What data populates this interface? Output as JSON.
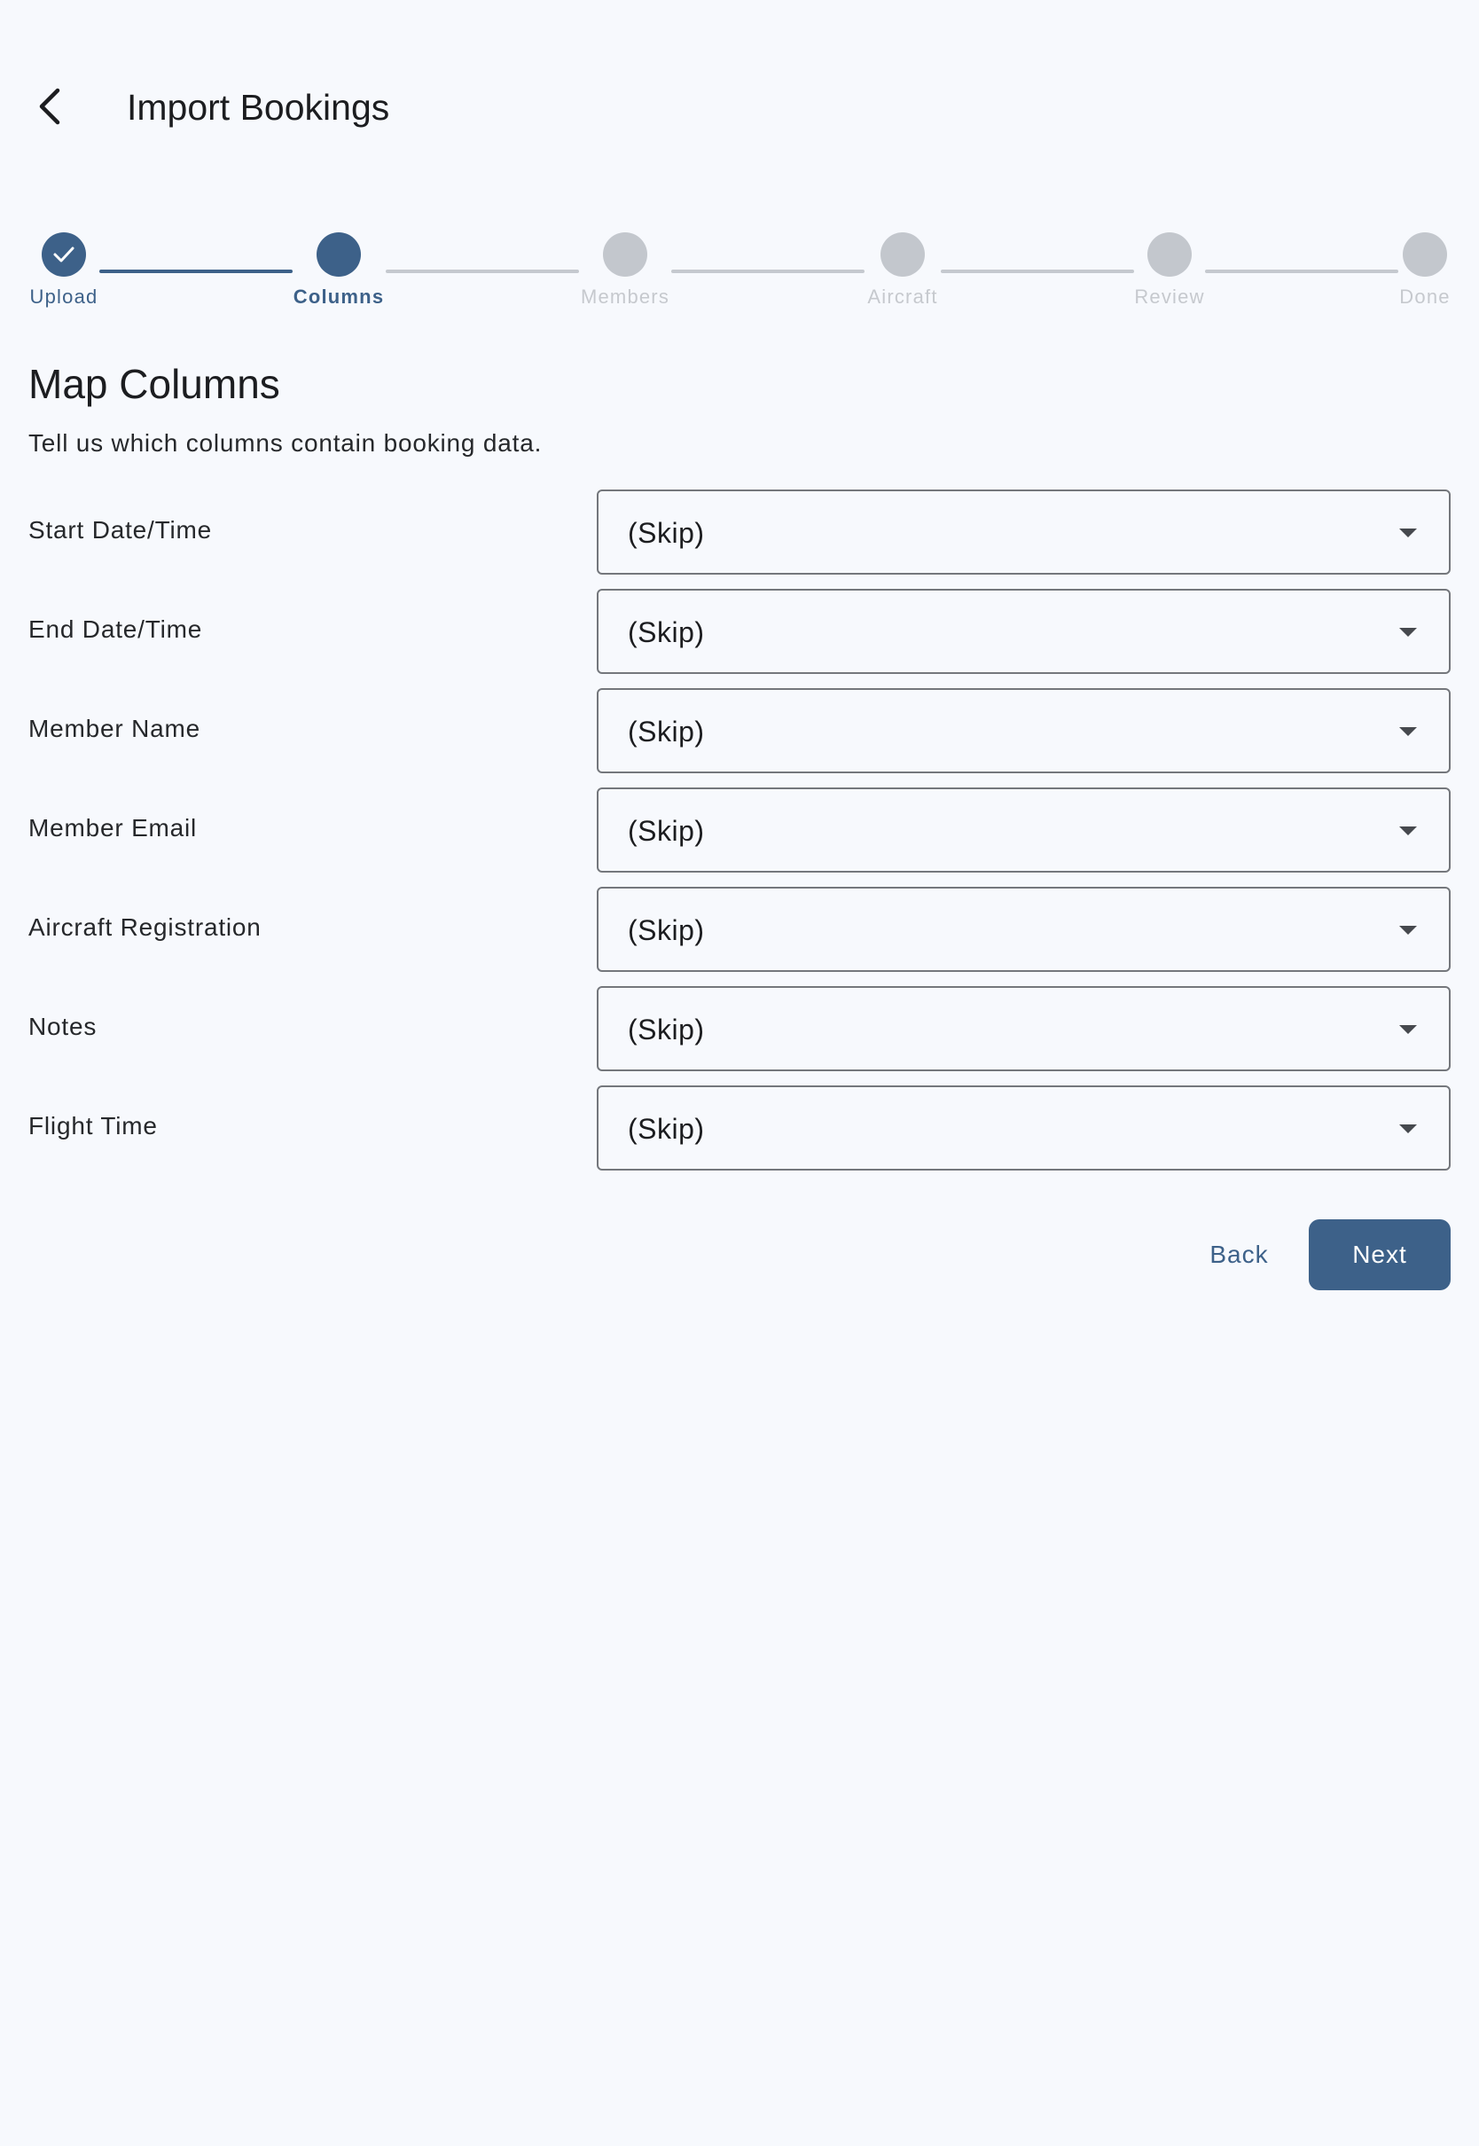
{
  "header": {
    "title": "Import Bookings",
    "back_icon": "arrow-back-icon"
  },
  "stepper": {
    "steps": [
      {
        "label": "Upload",
        "state": "complete"
      },
      {
        "label": "Columns",
        "state": "active"
      },
      {
        "label": "Members",
        "state": "pending"
      },
      {
        "label": "Aircraft",
        "state": "pending"
      },
      {
        "label": "Review",
        "state": "pending"
      },
      {
        "label": "Done",
        "state": "pending"
      }
    ],
    "colors": {
      "active": "#3d6189",
      "pending": "#c3c7cd"
    }
  },
  "section": {
    "title": "Map Columns",
    "subtitle": "Tell us which columns contain booking data."
  },
  "mappings": [
    {
      "label": "Start Date/Time",
      "value": "(Skip)"
    },
    {
      "label": "End Date/Time",
      "value": "(Skip)"
    },
    {
      "label": "Member Name",
      "value": "(Skip)"
    },
    {
      "label": "Member Email",
      "value": "(Skip)"
    },
    {
      "label": "Aircraft Registration",
      "value": "(Skip)"
    },
    {
      "label": "Notes",
      "value": "(Skip)"
    },
    {
      "label": "Flight Time",
      "value": "(Skip)"
    }
  ],
  "actions": {
    "back_label": "Back",
    "next_label": "Next"
  }
}
